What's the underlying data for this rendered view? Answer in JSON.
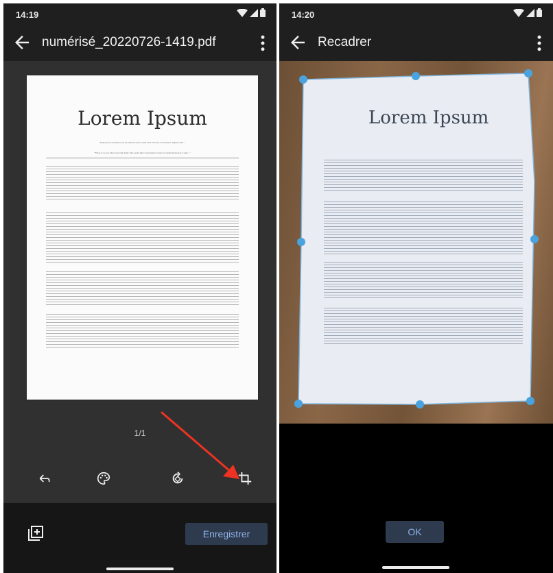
{
  "left_screen": {
    "status": {
      "time": "14:19"
    },
    "appbar": {
      "title": "numérisé_20220726-1419.pdf"
    },
    "document": {
      "title": "Lorem Ipsum",
      "subtitle_line1": "\"Neque porro quisquam est qui dolorem ipsum quia dolor sit amet, consectetur, adipisci velit...\"",
      "subtitle_line2": "\"There is no one who loves pain itself, who seeks after it and wants to have it, simply because it is pain...\""
    },
    "page_counter": "1/1",
    "tools": [
      "undo-icon",
      "palette-icon",
      "rotate-icon",
      "crop-icon"
    ],
    "save_label": "Enregistrer"
  },
  "right_screen": {
    "status": {
      "time": "14:20"
    },
    "appbar": {
      "title": "Recadrer"
    },
    "document": {
      "title": "Lorem Ipsum"
    },
    "ok_label": "OK"
  },
  "colors": {
    "accent_button_bg": "#2e3b4e",
    "accent_button_text": "#8fb2e8",
    "crop_handle": "#4aa3df",
    "arrow": "#ee3322"
  }
}
